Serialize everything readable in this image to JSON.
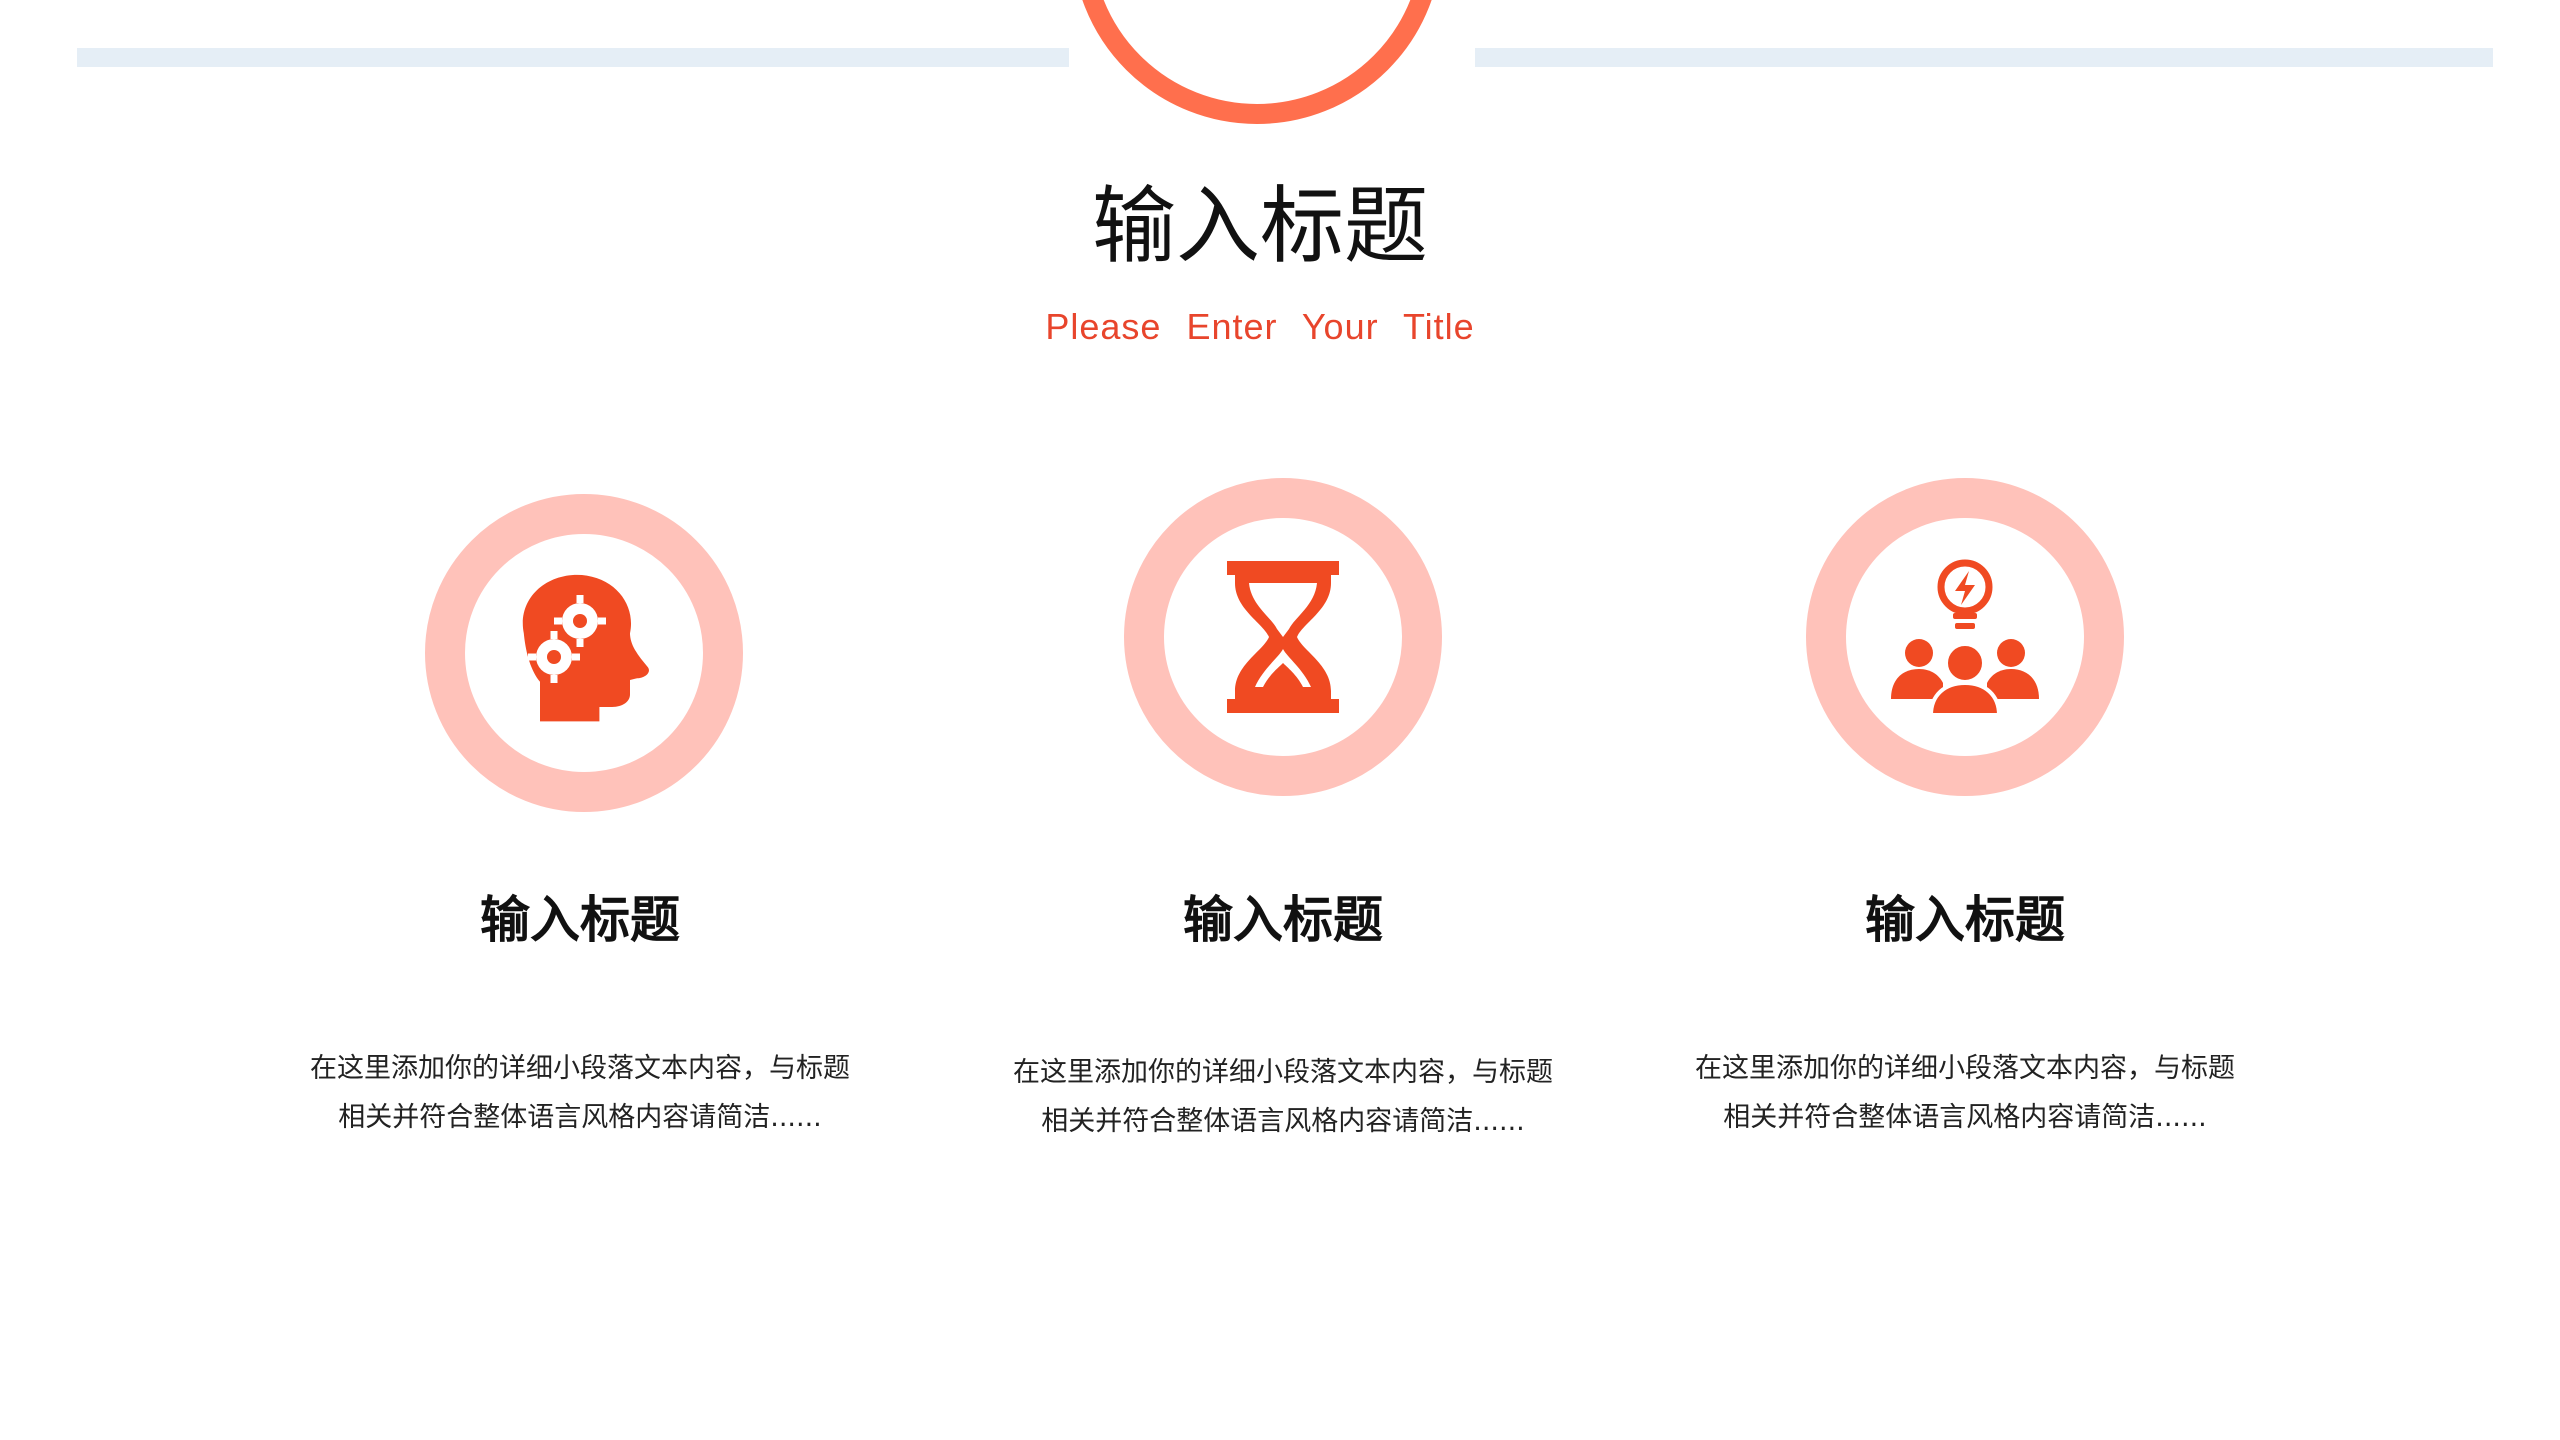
{
  "header": {
    "title": "输入标题",
    "subtitle": "Please  Enter  Your  Title"
  },
  "colors": {
    "accent": "#e8452c",
    "ring": "#ffc2ba",
    "top_ring": "#ff6f4d",
    "divider": "#e5eef6"
  },
  "cards": [
    {
      "icon": "head-gears-icon",
      "title": "输入标题",
      "desc_line1": "在这里添加你的详细小段落文本内容，与标题",
      "desc_line2": "相关并符合整体语言风格内容请简洁......"
    },
    {
      "icon": "hourglass-icon",
      "title": "输入标题",
      "desc_line1": "在这里添加你的详细小段落文本内容，与标题",
      "desc_line2": "相关并符合整体语言风格内容请简洁......"
    },
    {
      "icon": "team-idea-icon",
      "title": "输入标题",
      "desc_line1": "在这里添加你的详细小段落文本内容，与标题",
      "desc_line2": "相关并符合整体语言风格内容请简洁......"
    }
  ]
}
